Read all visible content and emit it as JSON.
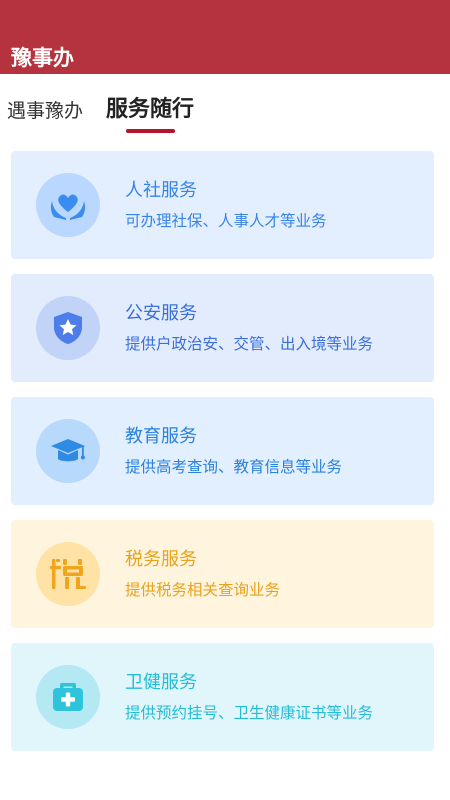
{
  "header": {
    "title": "豫事办",
    "bg_color": "#b5333e"
  },
  "tabs": [
    {
      "label": "遇事豫办",
      "active": false
    },
    {
      "label": "服务随行",
      "active": true
    }
  ],
  "services": [
    {
      "icon": "heart-in-hands-icon",
      "title": "人社服务",
      "desc": "可办理社保、人事人才等业务",
      "card_bg": "#e3efff",
      "circle_bg": "#b9d7ff",
      "icon_color": "#3b8cf0",
      "text_color": "#3883e8"
    },
    {
      "icon": "shield-star-icon",
      "title": "公安服务",
      "desc": "提供户政治安、交管、出入境等业务",
      "card_bg": "#e3ecfd",
      "circle_bg": "#c2d3f8",
      "icon_color": "#4d7de8",
      "text_color": "#3a6fdc"
    },
    {
      "icon": "graduation-cap-icon",
      "title": "教育服务",
      "desc": "提供高考查询、教育信息等业务",
      "card_bg": "#e2effe",
      "circle_bg": "#b7d9fb",
      "icon_color": "#2f8ae3",
      "text_color": "#2b82dc"
    },
    {
      "icon": "tax-character-icon",
      "title": "税务服务",
      "desc": "提供税务相关查询业务",
      "card_bg": "#fff4dd",
      "circle_bg": "#ffe2a5",
      "icon_color": "#f0a51e",
      "text_color": "#e9a21a"
    },
    {
      "icon": "medical-kit-icon",
      "title": "卫健服务",
      "desc": "提供预约挂号、卫生健康证书等业务",
      "card_bg": "#e0f6fb",
      "circle_bg": "#b4e8f2",
      "icon_color": "#2ec4dc",
      "text_color": "#25bcd6"
    }
  ]
}
